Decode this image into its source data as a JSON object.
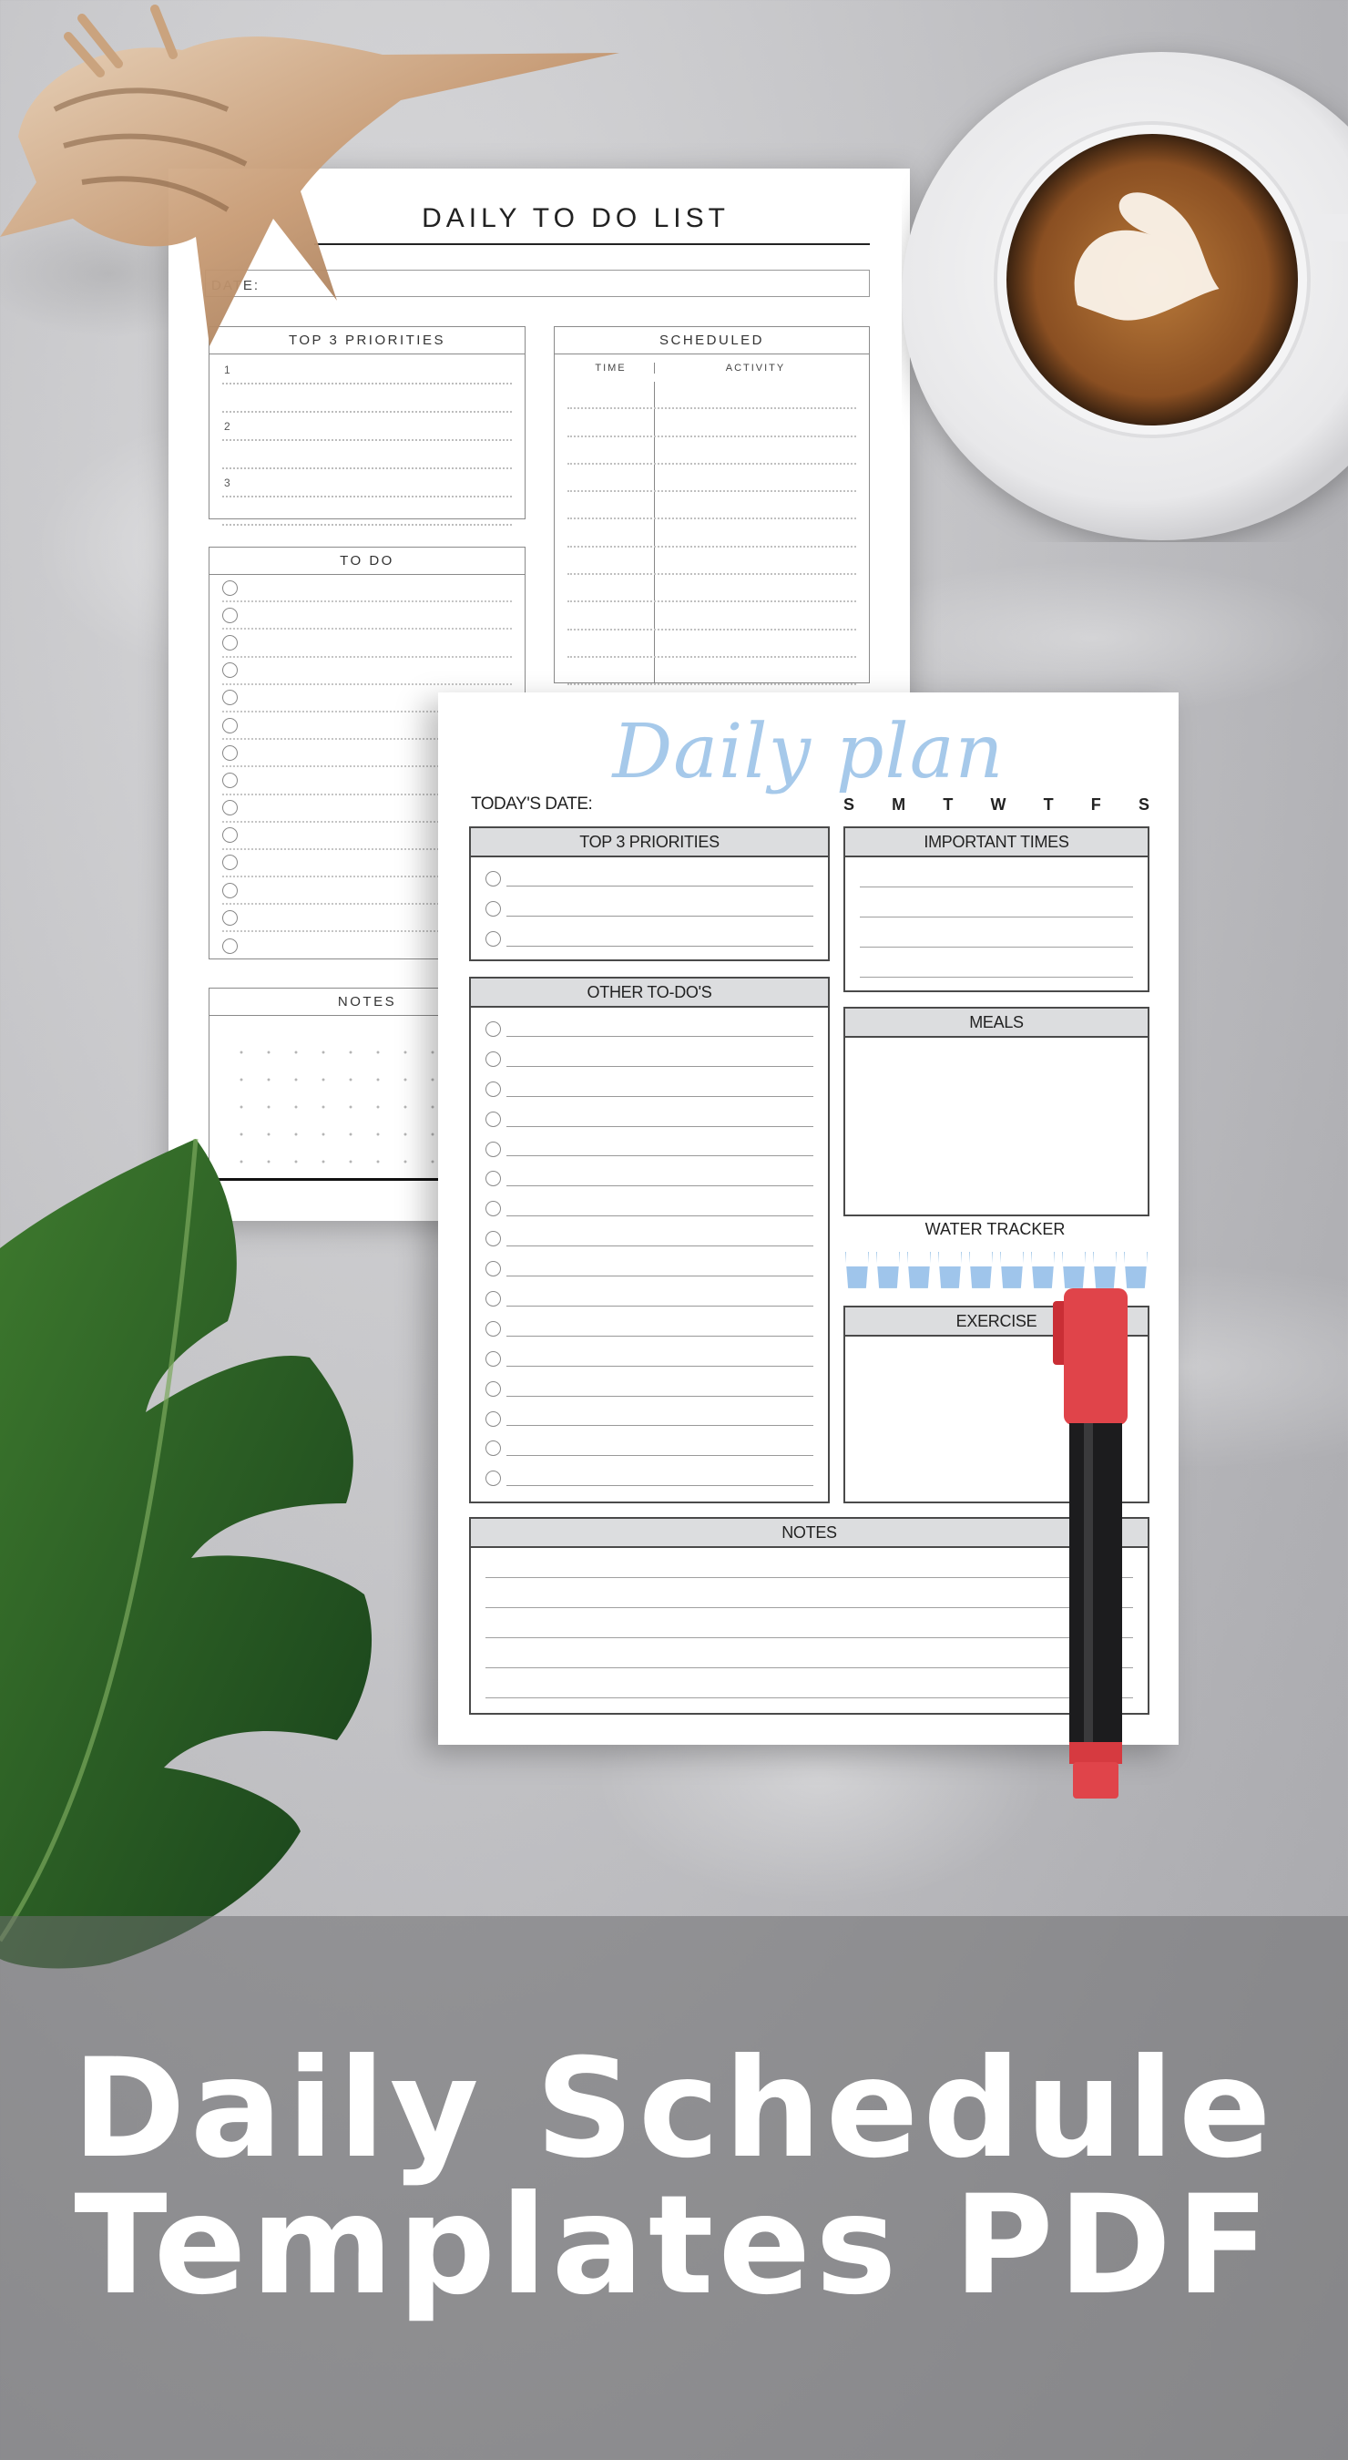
{
  "back_sheet": {
    "title": "DAILY TO DO LIST",
    "date_label": "DATE:",
    "priorities": {
      "header": "TOP 3 PRIORITIES",
      "numbers": [
        "1",
        "2",
        "3"
      ]
    },
    "scheduled": {
      "header": "SCHEDULED",
      "col_time": "TIME",
      "col_activity": "ACTIVITY",
      "row_count": 11
    },
    "todo": {
      "header": "TO DO",
      "item_count": 14
    },
    "notes": {
      "header": "NOTES"
    }
  },
  "front_sheet": {
    "title": "Daily plan",
    "date_label": "TODAY'S DATE:",
    "weekdays": [
      "S",
      "M",
      "T",
      "W",
      "T",
      "F",
      "S"
    ],
    "priorities": {
      "header": "TOP 3 PRIORITIES",
      "item_count": 3
    },
    "important_times": {
      "header": "IMPORTANT TIMES",
      "line_count": 4
    },
    "other_todos": {
      "header": "OTHER TO-DO'S",
      "item_count": 16
    },
    "meals": {
      "header": "MEALS"
    },
    "water_tracker": {
      "label": "WATER TRACKER",
      "glass_count": 10
    },
    "exercise": {
      "header": "EXERCISE"
    },
    "notes": {
      "header": "NOTES",
      "line_count": 5
    }
  },
  "banner": {
    "line1": "Daily Schedule",
    "line2": "Templates PDF"
  },
  "colors": {
    "title_blue": "#a6c9ea",
    "header_gray": "#dcdddf",
    "water_blue": "#9fc5eb",
    "marker_red": "#d9353c"
  },
  "decor": [
    "seashell",
    "coffee-cup",
    "monstera-leaf",
    "marker-pen"
  ]
}
